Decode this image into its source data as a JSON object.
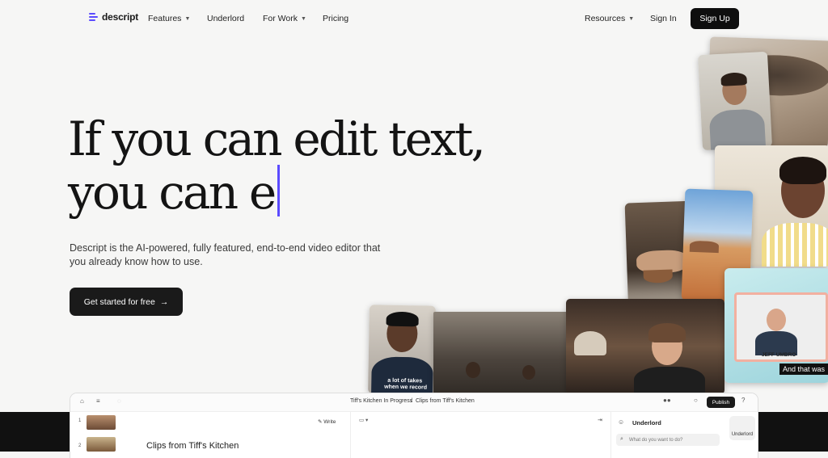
{
  "nav": {
    "logo": "descript",
    "features": "Features",
    "underlord": "Underlord",
    "for_work": "For Work",
    "pricing": "Pricing",
    "resources": "Resources",
    "sign_in": "Sign In",
    "sign_up": "Sign Up"
  },
  "hero": {
    "line1": "If you can edit text,",
    "line2": "you can e",
    "subtitle": "Descript is the AI-powered, fully featured, end-to-end video editor that you already know how to use.",
    "cta": "Get started for free",
    "cta_arrow": "→"
  },
  "tiles": {
    "caption_small": "a lot of takes",
    "caption_small2": "when we record",
    "name_tag": "JEFF UMBRO",
    "subtitle_caption": "And that was"
  },
  "app": {
    "breadcrumb_project": "Tiff's Kitchen In Progress",
    "breadcrumb_sep": "/",
    "breadcrumb_comp": "Clips from Tiff's Kitchen",
    "publish": "Publish",
    "write": "Write",
    "doc_title": "Clips from Tiff's Kitchen",
    "row1": "1",
    "row2": "2",
    "underlord_title": "Underlord",
    "underlord_placeholder": "What do you want to do?",
    "underlord_button": "Underlord"
  },
  "colors": {
    "accent": "#5b4bff",
    "dark": "#111111",
    "background": "#f6f6f5"
  }
}
